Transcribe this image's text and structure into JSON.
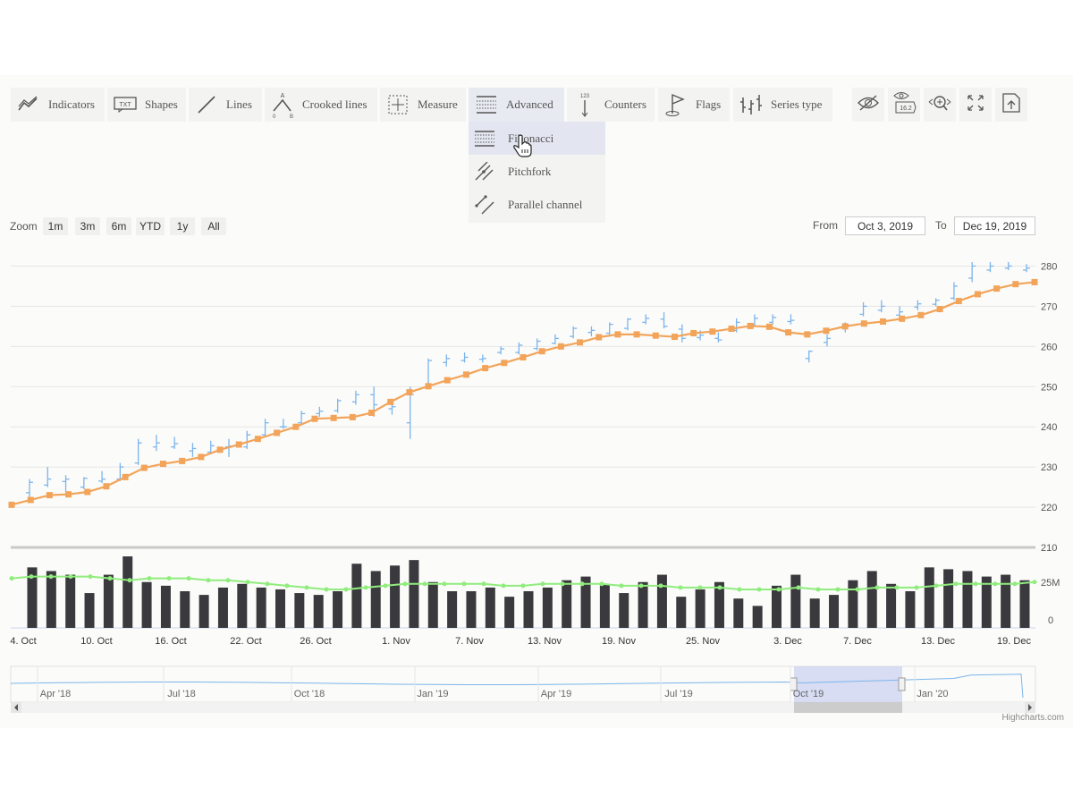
{
  "toolbar": {
    "items": [
      {
        "label": "Indicators",
        "icon": "indicators-icon"
      },
      {
        "label": "Shapes",
        "icon": "txt-shapes-icon"
      },
      {
        "label": "Lines",
        "icon": "line-icon"
      },
      {
        "label": "Crooked lines",
        "icon": "crooked-lines-icon"
      },
      {
        "label": "Measure",
        "icon": "measure-icon"
      },
      {
        "label": "Advanced",
        "icon": "fibonacci-grid-icon"
      },
      {
        "label": "Counters",
        "icon": "counter-icon"
      },
      {
        "label": "Flags",
        "icon": "flag-icon"
      },
      {
        "label": "Series type",
        "icon": "series-type-icon"
      }
    ],
    "crooked_a": "A",
    "crooked_0": "0",
    "crooked_b": "B",
    "counters_num": "123",
    "right_icons": [
      "hide-eye-icon",
      "current-price-icon",
      "zoom-change-icon",
      "fullscreen-icon",
      "save-chart-icon"
    ],
    "current_price_value": "16.2"
  },
  "advanced_menu": {
    "items": [
      {
        "label": "Fibonacci",
        "icon": "fibonacci-icon"
      },
      {
        "label": "Pitchfork",
        "icon": "pitchfork-icon"
      },
      {
        "label": "Parallel channel",
        "icon": "parallel-channel-icon"
      }
    ]
  },
  "range_selector": {
    "zoom_label": "Zoom",
    "buttons": [
      "1m",
      "3m",
      "6m",
      "YTD",
      "1y",
      "All"
    ],
    "from_label": "From",
    "from_value": "Oct 3, 2019",
    "to_label": "To",
    "to_value": "Dec 19, 2019"
  },
  "navigator": {
    "labels": [
      "Apr '18",
      "Jul '18",
      "Oct '18",
      "Jan '19",
      "Apr '19",
      "Jul '19",
      "Oct '19",
      "Jan '20"
    ]
  },
  "credits": "Highcharts.com",
  "colors": {
    "ohlc": "#7cb5ec",
    "sma": "#f2a45a",
    "volume": "#3a3a3e",
    "volume_sma": "#90ed7d",
    "navigator_mask": "#ccd3f0"
  },
  "chart_data": {
    "type": "ohlc",
    "x_labels": [
      "4. Oct",
      "10. Oct",
      "16. Oct",
      "22. Oct",
      "26. Oct",
      "1. Nov",
      "7. Nov",
      "13. Nov",
      "19. Nov",
      "25. Nov",
      "3. Dec",
      "7. Dec",
      "13. Dec",
      "19. Dec"
    ],
    "price_axis": {
      "ticks": [
        210,
        220,
        230,
        240,
        250,
        260,
        270,
        280
      ],
      "range": [
        210,
        285
      ],
      "grid": true
    },
    "volume_axis": {
      "ticks": [
        "0",
        "25M"
      ],
      "range": [
        0,
        40000000
      ]
    },
    "price_ohlc": [
      [
        223.6,
        227.0,
        222.5,
        226.2
      ],
      [
        225.5,
        230.0,
        225.0,
        227.0
      ],
      [
        226.4,
        228.0,
        223.5,
        227.0
      ],
      [
        225.0,
        227.5,
        224.5,
        227.2
      ],
      [
        226.5,
        229.0,
        226.0,
        227.0
      ],
      [
        227.0,
        231.0,
        226.5,
        230.0
      ],
      [
        231.0,
        237.0,
        230.5,
        236.0
      ],
      [
        235.0,
        238.0,
        234.0,
        236.0
      ],
      [
        235.0,
        237.5,
        234.5,
        235.8
      ],
      [
        234.0,
        236.0,
        232.5,
        234.6
      ],
      [
        233.7,
        236.5,
        233.2,
        235.3
      ],
      [
        235.0,
        237.0,
        232.5,
        235.2
      ],
      [
        235.0,
        239.0,
        234.5,
        238.0
      ],
      [
        238.0,
        242.0,
        237.5,
        241.0
      ],
      [
        240.0,
        242.0,
        239.5,
        240.0
      ],
      [
        241.0,
        244.0,
        240.5,
        243.3
      ],
      [
        243.3,
        245.0,
        242.5,
        243.9
      ],
      [
        244.0,
        247.0,
        243.5,
        246.5
      ],
      [
        246.2,
        249.0,
        245.5,
        248.0
      ],
      [
        248.0,
        250.0,
        242.5,
        245.5
      ],
      [
        244.5,
        247.0,
        243.0,
        245.0
      ],
      [
        241.0,
        250.0,
        237.0,
        248.0
      ],
      [
        250.0,
        257.0,
        249.5,
        256.5
      ],
      [
        256.0,
        258.0,
        255.0,
        257.0
      ],
      [
        256.5,
        258.5,
        256.0,
        257.3
      ],
      [
        256.8,
        258.0,
        256.0,
        257.0
      ],
      [
        258.5,
        260.0,
        258.0,
        259.4
      ],
      [
        258.5,
        261.0,
        258.0,
        260.3
      ],
      [
        259.5,
        262.0,
        259.0,
        261.3
      ],
      [
        260.8,
        263.0,
        260.5,
        262.0
      ],
      [
        262.5,
        265.0,
        262.0,
        264.5
      ],
      [
        263.5,
        265.0,
        262.5,
        264.0
      ],
      [
        263.3,
        266.0,
        262.5,
        265.5
      ],
      [
        264.5,
        267.0,
        264.0,
        266.8
      ],
      [
        266.0,
        268.0,
        265.5,
        267.0
      ],
      [
        266.8,
        268.5,
        264.5,
        265.0
      ],
      [
        264.3,
        265.5,
        261.0,
        262.0
      ],
      [
        262.2,
        264.0,
        261.5,
        262.8
      ],
      [
        262.0,
        263.5,
        261.0,
        261.6
      ],
      [
        264.0,
        267.0,
        263.5,
        266.0
      ],
      [
        265.4,
        268.0,
        265.0,
        267.0
      ],
      [
        266.0,
        268.0,
        265.5,
        267.2
      ],
      [
        266.2,
        268.0,
        265.5,
        266.5
      ],
      [
        257.0,
        259.0,
        256.0,
        258.8
      ],
      [
        261.0,
        263.0,
        260.0,
        262.0
      ],
      [
        264.5,
        266.0,
        263.5,
        265.5
      ],
      [
        268.0,
        271.0,
        267.5,
        270.0
      ],
      [
        269.0,
        271.5,
        268.5,
        270.0
      ],
      [
        267.8,
        270.0,
        267.0,
        268.6
      ],
      [
        269.8,
        271.5,
        269.0,
        270.6
      ],
      [
        270.5,
        272.0,
        270.0,
        271.5
      ],
      [
        272.0,
        276.0,
        271.5,
        275.0
      ],
      [
        277.0,
        281.0,
        276.0,
        280.0
      ],
      [
        279.0,
        281.0,
        278.5,
        280.0
      ],
      [
        279.5,
        281.0,
        279.0,
        280.0
      ],
      [
        279.0,
        280.5,
        278.5,
        279.5
      ]
    ],
    "sma_line": [
      220.6,
      221.8,
      223.0,
      223.2,
      223.8,
      225.2,
      227.5,
      229.8,
      230.8,
      231.5,
      232.5,
      234.3,
      235.6,
      237.0,
      238.5,
      240.0,
      242.0,
      242.2,
      242.4,
      243.5,
      246.2,
      248.6,
      250.1,
      251.6,
      253.0,
      254.6,
      255.9,
      257.3,
      258.8,
      260.0,
      261.0,
      262.3,
      263.0,
      263.0,
      262.7,
      262.4,
      263.3,
      263.7,
      264.4,
      265.1,
      264.9,
      263.5,
      263.0,
      263.9,
      265.0,
      265.7,
      266.2,
      266.9,
      267.8,
      269.3,
      271.3,
      273.0,
      274.4,
      275.5,
      276.0
    ],
    "volume": [
      33,
      31,
      29,
      19,
      29,
      39,
      25,
      23,
      20,
      18,
      22,
      24,
      22,
      21,
      19,
      18,
      20,
      35,
      31,
      34,
      37,
      25,
      20,
      20,
      22,
      17,
      20,
      22,
      26,
      28,
      24,
      19,
      25,
      29,
      17,
      21,
      25,
      16,
      12,
      23,
      29,
      16,
      18,
      26,
      31,
      24,
      20,
      33,
      32,
      31,
      28,
      29,
      26
    ],
    "volume_sma": [
      27,
      28,
      28,
      28,
      28,
      27,
      26,
      27,
      27,
      27,
      26,
      26,
      25,
      24,
      23,
      22,
      21,
      21,
      22,
      23,
      24,
      24,
      24,
      24,
      24,
      23,
      23,
      24,
      24,
      24,
      24,
      23,
      23,
      23,
      22,
      22,
      22,
      21,
      21,
      21,
      22,
      21,
      21,
      21,
      22,
      22,
      22,
      23,
      24,
      24,
      24,
      24,
      25
    ]
  }
}
